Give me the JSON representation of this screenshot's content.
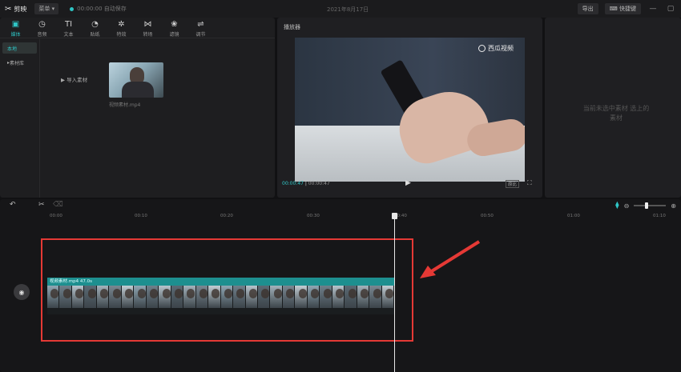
{
  "app": {
    "name": "剪映",
    "menu": "菜单",
    "autosave": "00:00:00 自动保存",
    "doc_title": "2021年8月17日",
    "export": "导出",
    "shortcut": "快捷键"
  },
  "media_tabs": [
    {
      "label": "媒体",
      "icon": "media-icon"
    },
    {
      "label": "音频",
      "icon": "audio-icon"
    },
    {
      "label": "文本",
      "icon": "text-icon"
    },
    {
      "label": "贴纸",
      "icon": "sticker-icon"
    },
    {
      "label": "特效",
      "icon": "effects-icon"
    },
    {
      "label": "转场",
      "icon": "transition-icon"
    },
    {
      "label": "滤镜",
      "icon": "filter-icon"
    },
    {
      "label": "调节",
      "icon": "adjust-icon"
    }
  ],
  "sidebar": [
    {
      "label": "本地"
    },
    {
      "label": "素材库"
    }
  ],
  "media": {
    "import_label": "导入素材",
    "thumb_name": "视频素材.mp4"
  },
  "player": {
    "title": "播放器",
    "watermark": "西瓜视频",
    "current_time": "00:00:47",
    "total_time": "00:00:47",
    "ratio": "原比",
    "play_icon": "play-icon"
  },
  "properties": {
    "empty_message": "当前未选中素材 选上的素材"
  },
  "timeline": {
    "ruler": [
      "00:00",
      "00:10",
      "00:20",
      "00:30",
      "00:40",
      "00:50",
      "01:00",
      "01:10"
    ],
    "clip": {
      "label": "视频素材.mp4  47.0s",
      "frame_count": 28
    },
    "accent": "#2fc6c6",
    "highlight_color": "#e53935"
  }
}
